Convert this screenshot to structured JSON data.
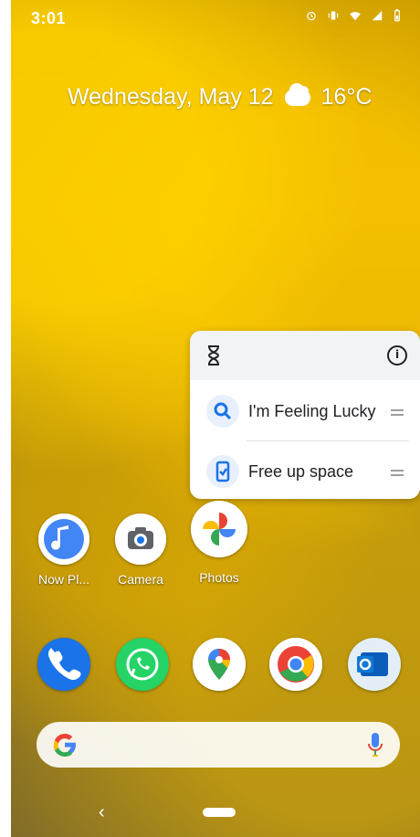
{
  "status_bar": {
    "time": "3:01",
    "icons": [
      "alarm-icon",
      "vibrate-icon",
      "wifi-icon",
      "signal-icon",
      "battery-icon"
    ]
  },
  "at_a_glance": {
    "date": "Wednesday, May 12",
    "weather_icon": "cloud-icon",
    "temperature": "16°C"
  },
  "shortcut_popup": {
    "header_icons": [
      "hourglass-icon",
      "info-icon"
    ],
    "items": [
      {
        "label": "I'm Feeling Lucky",
        "icon": "search-icon"
      },
      {
        "label": "Free up space",
        "icon": "phone-clean-icon"
      }
    ]
  },
  "home_apps": [
    {
      "label": "Now Pl...",
      "icon": "now-playing-icon"
    },
    {
      "label": "Camera",
      "icon": "camera-icon"
    },
    {
      "label": "Photos",
      "icon": "photos-icon"
    }
  ],
  "dock_apps": [
    {
      "label": "Phone",
      "icon": "phone-icon"
    },
    {
      "label": "WhatsApp",
      "icon": "whatsapp-icon"
    },
    {
      "label": "Maps",
      "icon": "maps-icon"
    },
    {
      "label": "Chrome",
      "icon": "chrome-icon"
    },
    {
      "label": "Outlook",
      "icon": "outlook-icon"
    }
  ],
  "search_bar": {
    "icon_left": "google-g-icon",
    "icon_right": "mic-icon"
  },
  "nav": {
    "back": "‹"
  },
  "colors": {
    "wallpaper_yellow": "#d6a800",
    "google_blue": "#4285F4",
    "google_red": "#EA4335",
    "google_yellow": "#FBBC05",
    "google_green": "#34A853"
  }
}
